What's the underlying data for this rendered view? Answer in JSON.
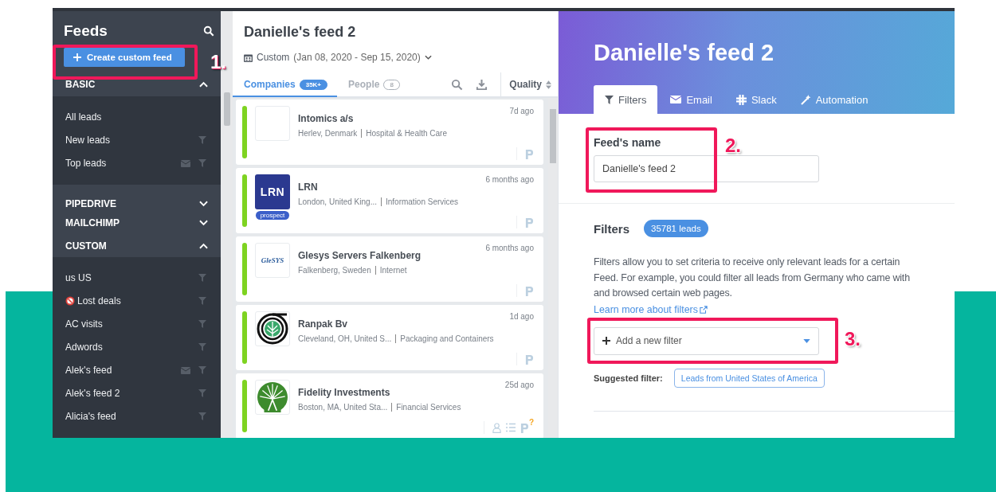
{
  "sidebar": {
    "title": "Feeds",
    "create_button": "Create custom feed",
    "sections": [
      {
        "title": "BASIC",
        "expanded": true,
        "items": [
          {
            "label": "All leads",
            "email": false,
            "filter": false,
            "prohibited": false
          },
          {
            "label": "New leads",
            "email": false,
            "filter": true,
            "prohibited": false
          },
          {
            "label": "Top leads",
            "email": true,
            "filter": true,
            "prohibited": false
          }
        ]
      },
      {
        "title": "PIPEDRIVE",
        "expanded": false
      },
      {
        "title": "MAILCHIMP",
        "expanded": false
      },
      {
        "title": "CUSTOM",
        "expanded": true,
        "items": [
          {
            "label": "us US",
            "email": false,
            "filter": true,
            "prohibited": false
          },
          {
            "label": "Lost deals",
            "email": false,
            "filter": true,
            "prohibited": true
          },
          {
            "label": "AC visits",
            "email": false,
            "filter": true,
            "prohibited": false
          },
          {
            "label": "Adwords",
            "email": false,
            "filter": true,
            "prohibited": false
          },
          {
            "label": "Alek's feed",
            "email": true,
            "filter": true,
            "prohibited": false
          },
          {
            "label": "Alek's feed 2",
            "email": false,
            "filter": true,
            "prohibited": false
          },
          {
            "label": "Alicia's feed",
            "email": false,
            "filter": true,
            "prohibited": false
          }
        ]
      }
    ]
  },
  "feed_list": {
    "title": "Danielle's feed 2",
    "range_label": "Custom",
    "range_dates": "(Jan 08, 2020 - Sep 15, 2020)",
    "tabs": [
      {
        "label": "Companies",
        "count": "35K+",
        "selected": true
      },
      {
        "label": "People",
        "count": "8",
        "selected": false
      }
    ],
    "sort_label": "Quality",
    "companies": [
      {
        "name": "Intomics a/s",
        "location": "Herlev, Denmark",
        "industry": "Hospital & Health Care",
        "time": "7d ago",
        "kind": "blank",
        "extra_icons": false
      },
      {
        "name": "LRN",
        "location": "London, United King...",
        "industry": "Information Services",
        "time": "6 months ago",
        "kind": "lrn",
        "logo_text": "LRN",
        "tag": "prospect",
        "extra_icons": false
      },
      {
        "name": "Glesys Servers Falkenberg",
        "location": "Falkenberg, Sweden",
        "industry": "Internet",
        "time": "6 months ago",
        "kind": "glesys",
        "logo_text": "GleSYS",
        "extra_icons": false
      },
      {
        "name": "Ranpak Bv",
        "location": "Cleveland, OH, United S...",
        "industry": "Packaging and Containers",
        "time": "1d ago",
        "kind": "ranpak",
        "extra_icons": false
      },
      {
        "name": "Fidelity Investments",
        "location": "Boston, MA, United Sta...",
        "industry": "Financial Services",
        "time": "25d ago",
        "kind": "fidelity",
        "extra_icons": true,
        "badge": "?"
      }
    ]
  },
  "detail": {
    "title": "Danielle's feed 2",
    "tabs": [
      {
        "label": "Filters",
        "kind": "filter",
        "selected": true
      },
      {
        "label": "Email",
        "kind": "mail",
        "selected": false
      },
      {
        "label": "Slack",
        "kind": "slack",
        "selected": false
      },
      {
        "label": "Automation",
        "kind": "wand",
        "selected": false
      }
    ],
    "name_label": "Feed's name",
    "name_value": "Danielle's feed 2",
    "filters_heading": "Filters",
    "leads_badge": "35781 leads",
    "description_lines": [
      "Filters allow you to set criteria to receive only relevant leads for a certain",
      "Feed. For example, you could filter all leads from Germany who came with",
      "and browsed certain web pages."
    ],
    "learn_link": "Learn more about filters",
    "add_filter": "Add a new filter",
    "suggested_label": "Suggested filter:",
    "suggested_chip": "Leads from United States of America"
  },
  "annotations": [
    {
      "number": "1."
    },
    {
      "number": "2."
    },
    {
      "number": "3."
    }
  ]
}
